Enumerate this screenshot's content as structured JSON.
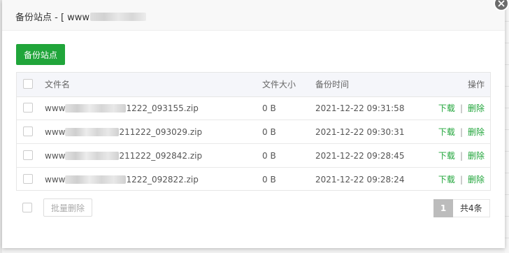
{
  "dialog": {
    "title_prefix": "备份站点 - [ www",
    "close_icon": "close-icon"
  },
  "toolbar": {
    "backup_label": "备份站点"
  },
  "table": {
    "headers": {
      "name": "文件名",
      "size": "文件大小",
      "time": "备份时间",
      "ops": "操作"
    },
    "rows": [
      {
        "name_prefix": "www",
        "name_suffix": "1222_093155.zip",
        "size": "0 B",
        "time": "2021-12-22 09:31:58",
        "download": "下载",
        "delete": "删除"
      },
      {
        "name_prefix": "www",
        "name_suffix": "211222_093029.zip",
        "size": "0 B",
        "time": "2021-12-22 09:30:31",
        "download": "下载",
        "delete": "删除"
      },
      {
        "name_prefix": "www",
        "name_suffix": "211222_092842.zip",
        "size": "0 B",
        "time": "2021-12-22 09:28:45",
        "download": "下载",
        "delete": "删除"
      },
      {
        "name_prefix": "www",
        "name_suffix": "1222_092822.zip",
        "size": "0 B",
        "time": "2021-12-22 09:28:24",
        "download": "下载",
        "delete": "删除"
      }
    ],
    "separator": "|"
  },
  "footer": {
    "batch_delete_label": "批量删除",
    "current_page": "1",
    "total_label": "共4条"
  },
  "colors": {
    "accent": "#20a53a",
    "page_active": "#bcbcbc"
  }
}
